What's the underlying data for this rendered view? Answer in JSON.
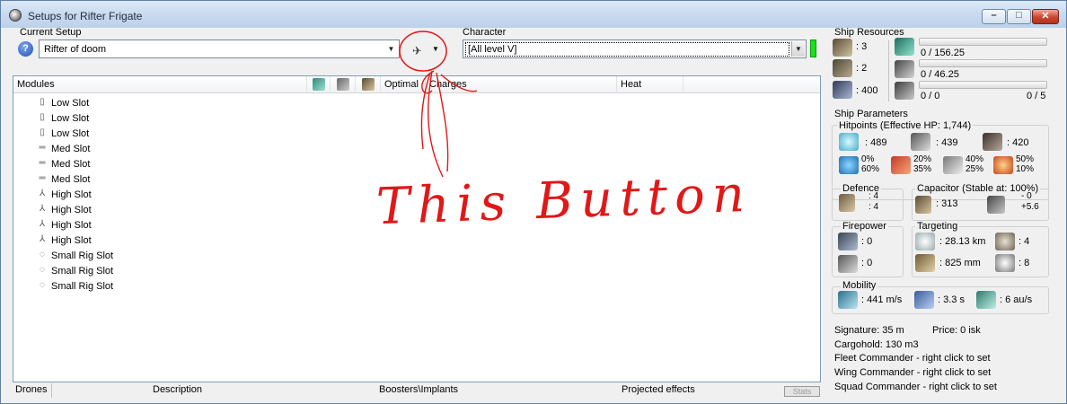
{
  "window": {
    "title": "Setups for Rifter Frigate"
  },
  "setup": {
    "label": "Current Setup",
    "value": "Rifter of doom",
    "help": "?"
  },
  "character": {
    "label": "Character",
    "value": "[All level V]"
  },
  "columns": {
    "modules": "Modules",
    "optimal": "Optimal",
    "charges": "Charges",
    "heat": "Heat"
  },
  "slots": [
    {
      "label": "Low Slot",
      "icon": "low-slot-icon"
    },
    {
      "label": "Low Slot",
      "icon": "low-slot-icon"
    },
    {
      "label": "Low Slot",
      "icon": "low-slot-icon"
    },
    {
      "label": "Med Slot",
      "icon": "med-slot-icon"
    },
    {
      "label": "Med Slot",
      "icon": "med-slot-icon"
    },
    {
      "label": "Med Slot",
      "icon": "med-slot-icon"
    },
    {
      "label": "High Slot",
      "icon": "high-slot-icon"
    },
    {
      "label": "High Slot",
      "icon": "high-slot-icon"
    },
    {
      "label": "High Slot",
      "icon": "high-slot-icon"
    },
    {
      "label": "High Slot",
      "icon": "high-slot-icon"
    },
    {
      "label": "Small Rig Slot",
      "icon": "rig-slot-icon"
    },
    {
      "label": "Small Rig Slot",
      "icon": "rig-slot-icon"
    },
    {
      "label": "Small Rig Slot",
      "icon": "rig-slot-icon"
    }
  ],
  "annotation": {
    "text": "This Button"
  },
  "tabs": {
    "drones": "Drones",
    "description": "Description",
    "boosters": "Boosters\\Implants",
    "projected": "Projected effects",
    "stats": "Stats"
  },
  "resources": {
    "title": "Ship Resources",
    "turrets": ": 3",
    "launchers": ": 2",
    "calibration": ": 400",
    "cpu": "0 / 156.25",
    "powergrid": "0 / 46.25",
    "drone_bay": "0 / 0",
    "drone_bandwidth": "0 / 5",
    "cpu_used_fraction": 0,
    "powergrid_used_fraction": 0,
    "drones_used_fraction": 0
  },
  "params": {
    "title": "Ship Parameters",
    "hitpoints_title": "Hitpoints (Effective HP: 1,744)",
    "shield_hp": ": 489",
    "armor_hp": ": 439",
    "structure_hp": ": 420",
    "res_em": [
      "0%",
      "60%"
    ],
    "res_thermal": [
      "20%",
      "35%"
    ],
    "res_kinetic": [
      "40%",
      "25%"
    ],
    "res_explosive": [
      "50%",
      "10%"
    ],
    "defence_title": "Defence",
    "defence_a": ": 4",
    "defence_b": ": 4",
    "capacitor_title": "Capacitor (Stable at: 100%)",
    "capacitor_amount": ": 313",
    "capacitor_delta_a": "- 0",
    "capacitor_delta_b": "+5.6",
    "firepower_title": "Firepower",
    "firepower_a": ": 0",
    "firepower_b": ": 0",
    "targeting_title": "Targeting",
    "target_range": ": 28.13 km",
    "max_targets": ": 4",
    "scan_res": ": 825 mm",
    "sensor_strength": ": 8",
    "mobility_title": "Mobility",
    "speed": ": 441 m/s",
    "align": ": 3.3 s",
    "warp": ": 6 au/s",
    "signature": "Signature: 35 m",
    "price": "Price: 0 isk",
    "cargohold": "Cargohold: 130 m3",
    "fleet_cmd": "Fleet Commander - right click to set",
    "wing_cmd": "Wing Commander - right click to set",
    "squad_cmd": "Squad Commander - right click to set"
  }
}
